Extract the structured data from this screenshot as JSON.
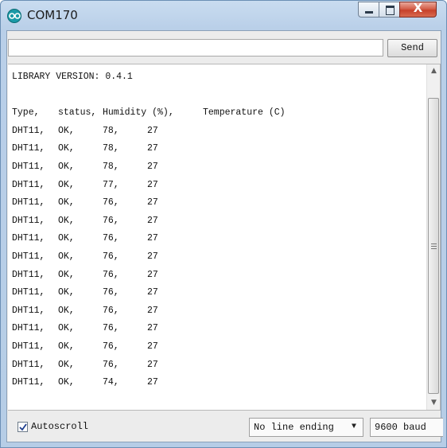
{
  "window": {
    "title": "COM170",
    "close_glyph": "X"
  },
  "input": {
    "value": "",
    "send_label": "Send"
  },
  "output": {
    "library_line": "LIBRARY VERSION: 0.4.1",
    "header": [
      "Type,",
      "status,",
      "Humidity (%),",
      "Temperature (C)"
    ],
    "rows": [
      [
        "DHT11,",
        "OK,",
        "78,",
        "27"
      ],
      [
        "DHT11,",
        "OK,",
        "78,",
        "27"
      ],
      [
        "DHT11,",
        "OK,",
        "78,",
        "27"
      ],
      [
        "DHT11,",
        "OK,",
        "77,",
        "27"
      ],
      [
        "DHT11,",
        "OK,",
        "76,",
        "27"
      ],
      [
        "DHT11,",
        "OK,",
        "76,",
        "27"
      ],
      [
        "DHT11,",
        "OK,",
        "76,",
        "27"
      ],
      [
        "DHT11,",
        "OK,",
        "76,",
        "27"
      ],
      [
        "DHT11,",
        "OK,",
        "76,",
        "27"
      ],
      [
        "DHT11,",
        "OK,",
        "76,",
        "27"
      ],
      [
        "DHT11,",
        "OK,",
        "76,",
        "27"
      ],
      [
        "DHT11,",
        "OK,",
        "76,",
        "27"
      ],
      [
        "DHT11,",
        "OK,",
        "76,",
        "27"
      ],
      [
        "DHT11,",
        "OK,",
        "76,",
        "27"
      ],
      [
        "DHT11,",
        "OK,",
        "74,",
        "27"
      ]
    ]
  },
  "footer": {
    "autoscroll_label": "Autoscroll",
    "autoscroll_checked": true,
    "line_ending": "No line ending",
    "baud": "9600 baud"
  },
  "icons": {
    "app": "arduino-icon",
    "dropdown": "chevron-down-icon"
  }
}
